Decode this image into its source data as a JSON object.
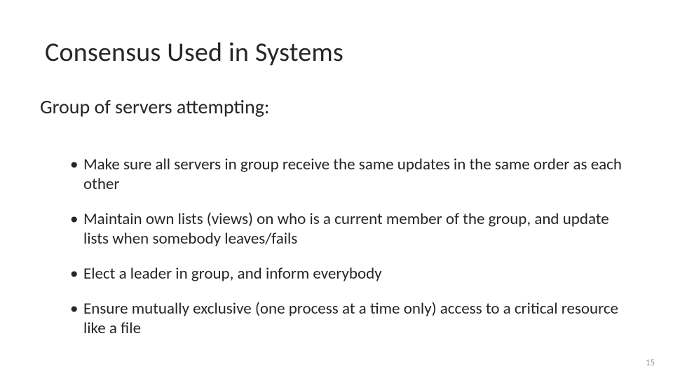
{
  "title": "Consensus Used in Systems",
  "subtitle": "Group of servers attempting:",
  "bullets": [
    "Make sure all servers in group receive the same updates in the same order as each other",
    "Maintain own lists (views) on who is a current member of the group, and update lists when somebody leaves/fails",
    "Elect a leader in group, and inform everybody",
    "Ensure mutually exclusive (one process at a time only) access to a critical resource like a file"
  ],
  "page_number": "15"
}
